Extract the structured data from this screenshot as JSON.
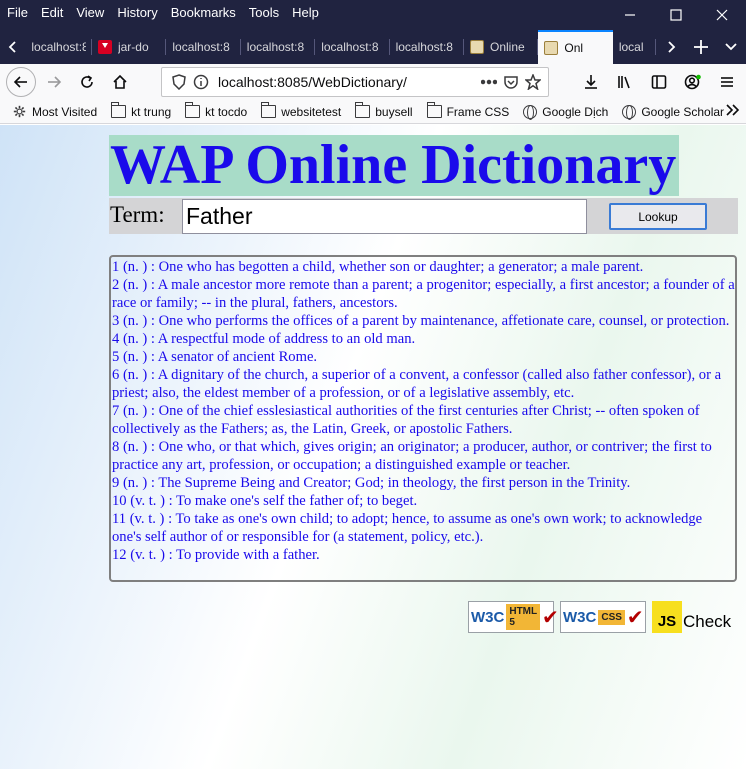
{
  "menubar": {
    "items": [
      {
        "label": "File"
      },
      {
        "label": "Edit"
      },
      {
        "label": "View"
      },
      {
        "label": "History"
      },
      {
        "label": "Bookmarks"
      },
      {
        "label": "Tools"
      },
      {
        "label": "Help"
      }
    ]
  },
  "tabs": [
    {
      "label": "localhost:8",
      "favicon": "none"
    },
    {
      "label": "jar-do",
      "favicon": "download-red"
    },
    {
      "label": "localhost:8",
      "favicon": "none"
    },
    {
      "label": "localhost:8",
      "favicon": "none"
    },
    {
      "label": "localhost:8",
      "favicon": "none"
    },
    {
      "label": "localhost:8",
      "favicon": "none"
    },
    {
      "label": "Online",
      "favicon": "dictionary"
    },
    {
      "label": "Onl",
      "favicon": "dictionary",
      "active": true
    },
    {
      "label": "local",
      "favicon": "none"
    }
  ],
  "urlbar": {
    "url": "localhost:8085/WebDictionary/"
  },
  "bookmarks": [
    {
      "label": "Most Visited",
      "icon": "gear-icon"
    },
    {
      "label": "kt trung",
      "icon": "folder-icon"
    },
    {
      "label": "kt tocdo",
      "icon": "folder-icon"
    },
    {
      "label": "websitetest",
      "icon": "folder-icon"
    },
    {
      "label": "buysell",
      "icon": "folder-icon"
    },
    {
      "label": "Frame CSS",
      "icon": "folder-icon"
    },
    {
      "label": "Google Dịch",
      "icon": "globe-icon"
    },
    {
      "label": "Google Scholar",
      "icon": "globe-icon"
    }
  ],
  "page": {
    "title": "WAP Online Dictionary",
    "term_label": "Term:",
    "term_value": "Father",
    "lookup_label": "Lookup",
    "definitions": [
      "1 (n. ) : One who has begotten a child, whether son or daughter; a generator; a male parent.",
      "2 (n. ) : A male ancestor more remote than a parent; a progenitor; especially, a first ancestor; a founder of a race or family; -- in the plural, fathers, ancestors.",
      "3 (n. ) : One who performs the offices of a parent by maintenance, affetionate care, counsel, or protection.",
      "4 (n. ) : A respectful mode of address to an old man.",
      "5 (n. ) : A senator of ancient Rome.",
      "6 (n. ) : A dignitary of the church, a superior of a convent, a confessor (called also father confessor), or a priest; also, the eldest member of a profession, or of a legislative assembly, etc.",
      "7 (n. ) : One of the chief esslesiastical authorities of the first centuries after Christ; -- often spoken of collectively as the Fathers; as, the Latin, Greek, or apostolic Fathers.",
      "8 (n. ) : One who, or that which, gives origin; an originator; a producer, author, or contriver; the first to practice any art, profession, or occupation; a distinguished example or teacher.",
      "9 (n. ) : The Supreme Being and Creator; God; in theology, the first person in the Trinity.",
      "10 (v. t. ) : To make one's self the father of; to beget.",
      "11 (v. t. ) : To take as one's own child; to adopt; hence, to assume as one's own work; to acknowledge one's self author of or responsible for (a statement, policy, etc.).",
      "12 (v. t. ) : To provide with a father."
    ],
    "badges": {
      "w3c": "W3C",
      "html5": "HTML 5",
      "css": "CSS",
      "js": "JS",
      "check": "Check"
    }
  },
  "colors": {
    "title_text": "#1a0aeb",
    "title_bg": "#a8dcc8",
    "definition_text": "#1a0aeb",
    "titlebar_bg": "#202340",
    "active_tab_accent": "#0a84ff"
  }
}
